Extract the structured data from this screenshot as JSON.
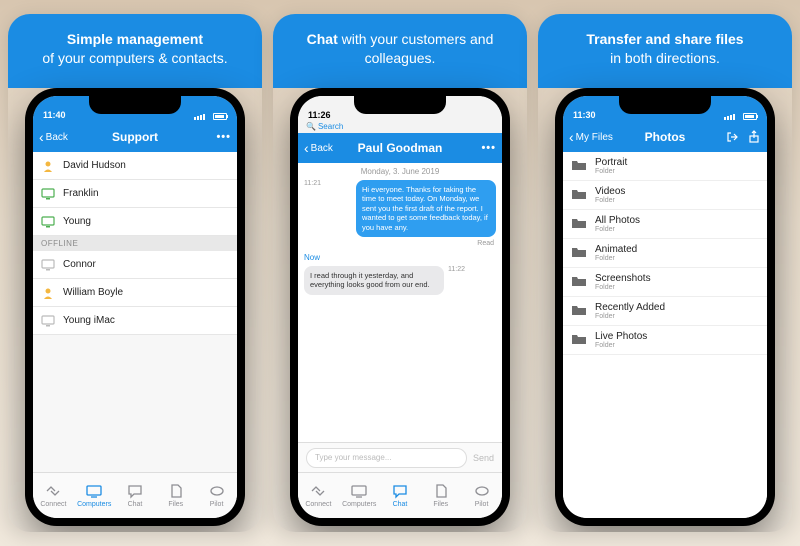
{
  "banners": {
    "s1_bold": "Simple management",
    "s1_rest": "of your computers & contacts.",
    "s2_bold": "Chat",
    "s2_rest": " with your customers and colleagues.",
    "s3_bold": "Transfer and share files",
    "s3_rest": "in both directions."
  },
  "screen1": {
    "time": "11:40",
    "back": "Back",
    "title": "Support",
    "online": [
      {
        "name": "David Hudson",
        "type": "user"
      },
      {
        "name": "Franklin",
        "type": "pc-on"
      },
      {
        "name": "Young",
        "type": "pc-on"
      }
    ],
    "offline_header": "OFFLINE",
    "offline": [
      {
        "name": "Connor",
        "type": "pc-off"
      },
      {
        "name": "William Boyle",
        "type": "user"
      },
      {
        "name": "Young iMac",
        "type": "pc-off"
      }
    ],
    "tabs": [
      "Connect",
      "Computers",
      "Chat",
      "Files",
      "Pilot"
    ],
    "active_tab": 1
  },
  "screen2": {
    "time": "11:26",
    "search_label": "Search",
    "back": "Back",
    "title": "Paul Goodman",
    "date": "Monday, 3. June 2019",
    "msg_out_time": "11:21",
    "msg_out": "Hi everyone. Thanks for taking the time to meet today. On Monday, we sent you the first draft of the report. I wanted to get some feedback today, if you have any.",
    "read": "Read",
    "now": "Now",
    "msg_in": "I read through it yesterday, and everything looks good from our end.",
    "msg_in_time": "11:22",
    "placeholder": "Type your message...",
    "send": "Send",
    "tabs": [
      "Connect",
      "Computers",
      "Chat",
      "Files",
      "Pilot"
    ],
    "active_tab": 2
  },
  "screen3": {
    "time": "11:30",
    "back": "My Files",
    "title": "Photos",
    "folders": [
      {
        "name": "Portrait",
        "sub": "Folder"
      },
      {
        "name": "Videos",
        "sub": "Folder"
      },
      {
        "name": "All Photos",
        "sub": "Folder"
      },
      {
        "name": "Animated",
        "sub": "Folder"
      },
      {
        "name": "Screenshots",
        "sub": "Folder"
      },
      {
        "name": "Recently Added",
        "sub": "Folder"
      },
      {
        "name": "Live Photos",
        "sub": "Folder"
      }
    ]
  }
}
